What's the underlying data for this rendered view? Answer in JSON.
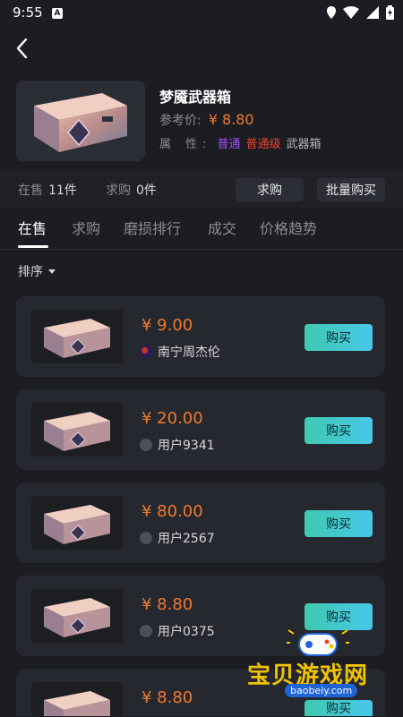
{
  "status_bar": {
    "time": "9:55",
    "badge": "A"
  },
  "header": {
    "back_icon": "chevron-left-icon"
  },
  "item": {
    "title": "梦魇武器箱",
    "ref_label": "参考价:",
    "ref_price": "¥ 8.80",
    "attr_label": "属 性:",
    "attr_1": "普通",
    "attr_2": "普通级",
    "attr_3": "武器箱"
  },
  "stats": {
    "on_sale_label": "在售",
    "on_sale_value": "11件",
    "wanted_label": "求购",
    "wanted_value": "0件",
    "want_button": "求购",
    "bulk_button": "批量购买"
  },
  "tabs": [
    "在售",
    "求购",
    "磨损排行",
    "成交",
    "价格趋势"
  ],
  "sort_label": "排序",
  "listings": [
    {
      "price": "¥ 9.00",
      "seller": "南宁周杰伦",
      "buy": "购买"
    },
    {
      "price": "¥ 20.00",
      "seller": "用户9341",
      "buy": "购买"
    },
    {
      "price": "¥ 80.00",
      "seller": "用户2567",
      "buy": "购买"
    },
    {
      "price": "¥ 8.80",
      "seller": "用户0375",
      "buy": "购买"
    },
    {
      "price": "¥ 8.80",
      "seller": "",
      "buy": "购买"
    }
  ],
  "watermark": {
    "text": "宝贝游戏网",
    "url": "baobeiy.com"
  },
  "colors": {
    "accent_price": "#f07a2e",
    "buy_gradient_start": "#3ec9b0",
    "buy_gradient_end": "#48c7e8",
    "purple": "#a54dff",
    "red": "#e8452d"
  }
}
